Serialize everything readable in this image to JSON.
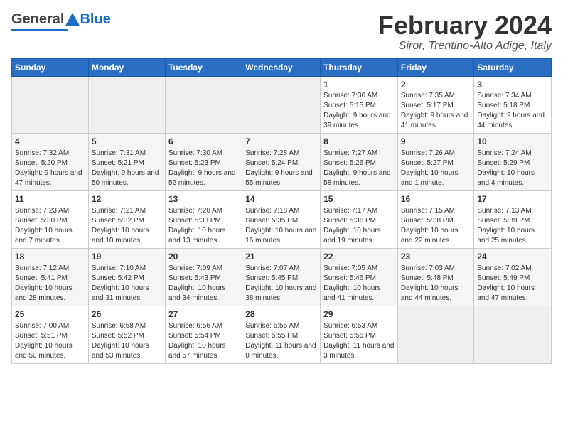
{
  "header": {
    "logo_general": "General",
    "logo_blue": "Blue",
    "month_title": "February 2024",
    "location": "Siror, Trentino-Alto Adige, Italy"
  },
  "days_of_week": [
    "Sunday",
    "Monday",
    "Tuesday",
    "Wednesday",
    "Thursday",
    "Friday",
    "Saturday"
  ],
  "weeks": [
    [
      {
        "day": "",
        "empty": true
      },
      {
        "day": "",
        "empty": true
      },
      {
        "day": "",
        "empty": true
      },
      {
        "day": "",
        "empty": true
      },
      {
        "day": "1",
        "sunrise": "7:36 AM",
        "sunset": "5:15 PM",
        "daylight": "9 hours and 39 minutes."
      },
      {
        "day": "2",
        "sunrise": "7:35 AM",
        "sunset": "5:17 PM",
        "daylight": "9 hours and 41 minutes."
      },
      {
        "day": "3",
        "sunrise": "7:34 AM",
        "sunset": "5:18 PM",
        "daylight": "9 hours and 44 minutes."
      }
    ],
    [
      {
        "day": "4",
        "sunrise": "7:32 AM",
        "sunset": "5:20 PM",
        "daylight": "9 hours and 47 minutes."
      },
      {
        "day": "5",
        "sunrise": "7:31 AM",
        "sunset": "5:21 PM",
        "daylight": "9 hours and 50 minutes."
      },
      {
        "day": "6",
        "sunrise": "7:30 AM",
        "sunset": "5:23 PM",
        "daylight": "9 hours and 52 minutes."
      },
      {
        "day": "7",
        "sunrise": "7:28 AM",
        "sunset": "5:24 PM",
        "daylight": "9 hours and 55 minutes."
      },
      {
        "day": "8",
        "sunrise": "7:27 AM",
        "sunset": "5:26 PM",
        "daylight": "9 hours and 58 minutes."
      },
      {
        "day": "9",
        "sunrise": "7:26 AM",
        "sunset": "5:27 PM",
        "daylight": "10 hours and 1 minute."
      },
      {
        "day": "10",
        "sunrise": "7:24 AM",
        "sunset": "5:29 PM",
        "daylight": "10 hours and 4 minutes."
      }
    ],
    [
      {
        "day": "11",
        "sunrise": "7:23 AM",
        "sunset": "5:30 PM",
        "daylight": "10 hours and 7 minutes."
      },
      {
        "day": "12",
        "sunrise": "7:21 AM",
        "sunset": "5:32 PM",
        "daylight": "10 hours and 10 minutes."
      },
      {
        "day": "13",
        "sunrise": "7:20 AM",
        "sunset": "5:33 PM",
        "daylight": "10 hours and 13 minutes."
      },
      {
        "day": "14",
        "sunrise": "7:18 AM",
        "sunset": "5:35 PM",
        "daylight": "10 hours and 16 minutes."
      },
      {
        "day": "15",
        "sunrise": "7:17 AM",
        "sunset": "5:36 PM",
        "daylight": "10 hours and 19 minutes."
      },
      {
        "day": "16",
        "sunrise": "7:15 AM",
        "sunset": "5:38 PM",
        "daylight": "10 hours and 22 minutes."
      },
      {
        "day": "17",
        "sunrise": "7:13 AM",
        "sunset": "5:39 PM",
        "daylight": "10 hours and 25 minutes."
      }
    ],
    [
      {
        "day": "18",
        "sunrise": "7:12 AM",
        "sunset": "5:41 PM",
        "daylight": "10 hours and 28 minutes."
      },
      {
        "day": "19",
        "sunrise": "7:10 AM",
        "sunset": "5:42 PM",
        "daylight": "10 hours and 31 minutes."
      },
      {
        "day": "20",
        "sunrise": "7:09 AM",
        "sunset": "5:43 PM",
        "daylight": "10 hours and 34 minutes."
      },
      {
        "day": "21",
        "sunrise": "7:07 AM",
        "sunset": "5:45 PM",
        "daylight": "10 hours and 38 minutes."
      },
      {
        "day": "22",
        "sunrise": "7:05 AM",
        "sunset": "5:46 PM",
        "daylight": "10 hours and 41 minutes."
      },
      {
        "day": "23",
        "sunrise": "7:03 AM",
        "sunset": "5:48 PM",
        "daylight": "10 hours and 44 minutes."
      },
      {
        "day": "24",
        "sunrise": "7:02 AM",
        "sunset": "5:49 PM",
        "daylight": "10 hours and 47 minutes."
      }
    ],
    [
      {
        "day": "25",
        "sunrise": "7:00 AM",
        "sunset": "5:51 PM",
        "daylight": "10 hours and 50 minutes."
      },
      {
        "day": "26",
        "sunrise": "6:58 AM",
        "sunset": "5:52 PM",
        "daylight": "10 hours and 53 minutes."
      },
      {
        "day": "27",
        "sunrise": "6:56 AM",
        "sunset": "5:54 PM",
        "daylight": "10 hours and 57 minutes."
      },
      {
        "day": "28",
        "sunrise": "6:55 AM",
        "sunset": "5:55 PM",
        "daylight": "11 hours and 0 minutes."
      },
      {
        "day": "29",
        "sunrise": "6:53 AM",
        "sunset": "5:56 PM",
        "daylight": "11 hours and 3 minutes."
      },
      {
        "day": "",
        "empty": true
      },
      {
        "day": "",
        "empty": true
      }
    ]
  ]
}
